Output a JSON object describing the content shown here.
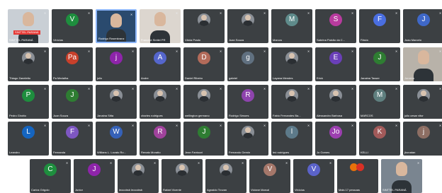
{
  "rows": [
    [
      {
        "name": "SINTTEL PARANÁ",
        "type": "video",
        "variant": "v0",
        "tag": "SINTTEL PARANÁ"
      },
      {
        "name": "Vinícius",
        "initial": "V",
        "color": "#1e8e3e"
      },
      {
        "name": "Rodrigo Rosenkranz",
        "type": "video",
        "variant": "v1"
      },
      {
        "name": "Francine Sinttel PR",
        "type": "video",
        "variant": "v2"
      },
      {
        "name": "Vânia Prado",
        "photo": true
      },
      {
        "name": "Juan Souza",
        "photo": true
      },
      {
        "name": "Marcos",
        "initial": "M",
        "color": "#5f8b8b"
      },
      {
        "name": "Sabrina Paixão da C...",
        "initial": "S",
        "color": "#b83b9e"
      },
      {
        "name": "Flávia",
        "initial": "F",
        "color": "#4a6ee0"
      },
      {
        "name": "Joao Marcelo",
        "initial": "J",
        "color": "#3f68c8"
      }
    ],
    [
      {
        "name": "Thiago Zaneletto",
        "photo": true
      },
      {
        "name": "Pa Medalha",
        "initial": "Pa",
        "color": "#c8402b"
      },
      {
        "name": "julio",
        "initial": "j",
        "color": "#8e24aa"
      },
      {
        "name": "Andre",
        "initial": "A",
        "color": "#5566cc"
      },
      {
        "name": "Daniel Ribeiro",
        "initial": "D",
        "color": "#b36b5a"
      },
      {
        "name": "gabriel",
        "initial": "g",
        "color": "#607080"
      },
      {
        "name": "Layana Mendes",
        "photo": true
      },
      {
        "name": "Erick",
        "initial": "E",
        "color": "#6a3fb8"
      },
      {
        "name": "Janaina Tasser",
        "initial": "J",
        "color": "#2e7d32"
      },
      {
        "name": "Janaina",
        "type": "video",
        "variant": "v3"
      }
    ],
    [
      {
        "name": "Pedro Girotto",
        "initial": "P",
        "color": "#1e8e3e"
      },
      {
        "name": "Juan Souza",
        "initial": "J",
        "color": "#2e7d32"
      },
      {
        "name": "Janaina Sitta",
        "photo": true
      },
      {
        "name": "charles rodrigues",
        "photo": true
      },
      {
        "name": "wellington germano",
        "photo": true
      },
      {
        "name": "Rodrigo Simoes",
        "initial": "R",
        "color": "#8e44ad"
      },
      {
        "name": "Fabio Fernandes Ba...",
        "photo": true
      },
      {
        "name": "Alessandro Barbosa",
        "photo": true
      },
      {
        "name": "MARCOS",
        "initial": "M",
        "color": "#5f7f7f"
      },
      {
        "name": "julio cesar vitor",
        "photo": true
      }
    ],
    [
      {
        "name": "Leandro",
        "initial": "L",
        "color": "#1565c0"
      },
      {
        "name": "Fernanda",
        "initial": "F",
        "color": "#7e57c2"
      },
      {
        "name": "Willians L. Lovato Ro...",
        "initial": "W",
        "color": "#3561b8"
      },
      {
        "name": "Renato Moratto",
        "initial": "R",
        "color": "#a0429c"
      },
      {
        "name": "Jean Fantozzi",
        "initial": "J",
        "color": "#2e7d32"
      },
      {
        "name": "Fernando Gemin",
        "photo": true
      },
      {
        "name": "leó rodrigues",
        "initial": "l",
        "color": "#5d7a8a"
      },
      {
        "name": "Jo Gomes",
        "initial": "Jo",
        "color": "#9c3fb0"
      },
      {
        "name": "KELLI",
        "initial": "K",
        "color": "#a25a5a"
      },
      {
        "name": "jhonatan",
        "initial": "j",
        "color": "#8d6e63"
      }
    ],
    [
      {
        "name": "Carlos Grigolo",
        "initial": "C",
        "color": "#1e8e3e"
      },
      {
        "name": "Junior",
        "initial": "J",
        "color": "#8e24aa"
      },
      {
        "name": "leocobsb leocobsb",
        "photo": true
      },
      {
        "name": "Rafael Vicente",
        "photo": true
      },
      {
        "name": "Agnaldo Trovan",
        "photo": true
      },
      {
        "name": "Viviane Marcal",
        "initial": "V",
        "color": "#a5776a"
      },
      {
        "name": "Vinícius",
        "initial": "V",
        "color": "#5b63c9"
      },
      {
        "name": "Mais 17 pessoas",
        "type": "more"
      },
      {
        "name": "SINTTEL PARANÁ",
        "type": "video",
        "variant": "v4"
      }
    ]
  ]
}
